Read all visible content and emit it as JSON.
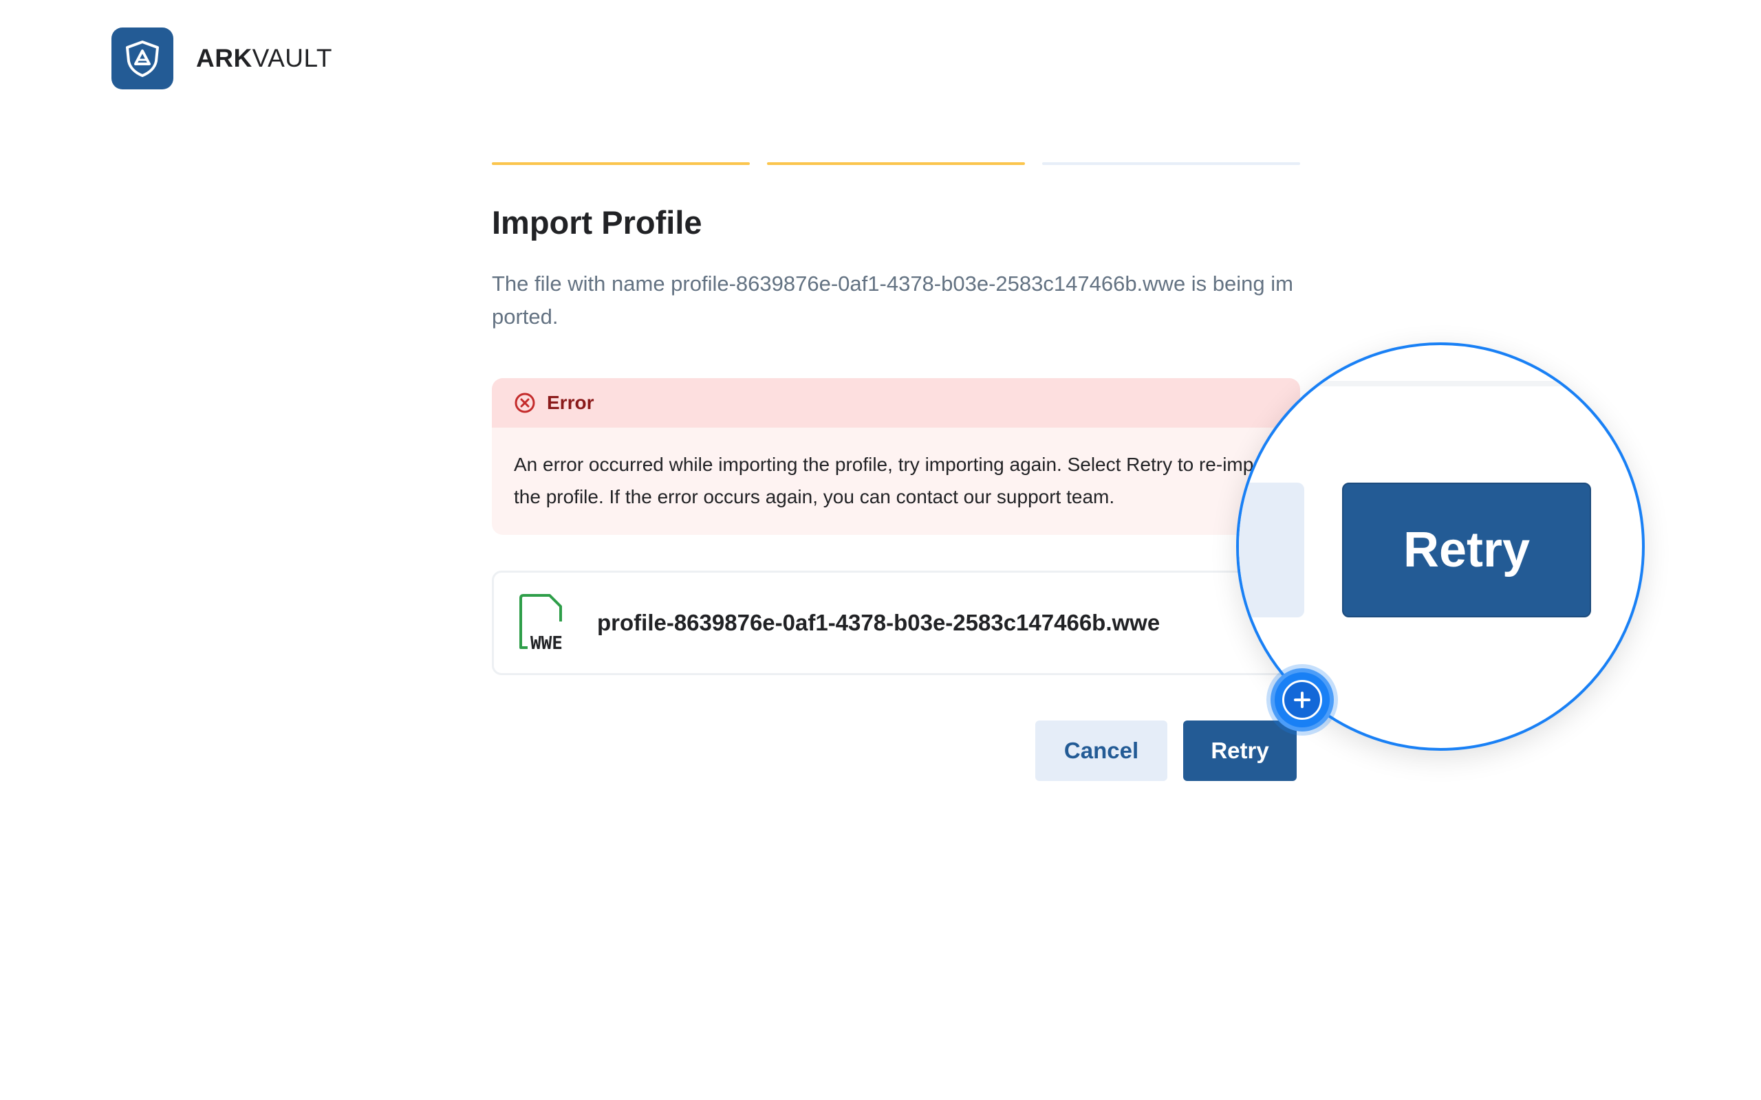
{
  "brand": {
    "name_bold": "ARK",
    "name_light": "VAULT",
    "icon": "ark-shield-logo-icon"
  },
  "steps": {
    "completed": 2,
    "total": 3
  },
  "page": {
    "title": "Import Profile",
    "description": "The file with name profile-8639876e-0af1-4378-b03e-2583c147466b.wwe is being imported."
  },
  "error": {
    "icon": "error-x-circle-icon",
    "title": "Error",
    "message": "An error occurred while importing the profile, try importing again. Select Retry to re-import the profile. If the error occurs again, you can contact our support team."
  },
  "file": {
    "icon": "wwe-file-icon",
    "icon_label": "WWE",
    "name": "profile-8639876e-0af1-4378-b03e-2583c147466b.wwe"
  },
  "actions": {
    "cancel_label": "Cancel",
    "retry_label": "Retry"
  },
  "magnifier": {
    "retry_label": "Retry",
    "badge_icon": "zoom-plus-icon"
  },
  "colors": {
    "primary": "#235B95",
    "step_done": "#FBC54D",
    "step_pending": "#E7EEF8",
    "error_bg": "#FDDFDF",
    "error_text": "#8A1A1A",
    "magnifier_ring": "#1980F5"
  }
}
